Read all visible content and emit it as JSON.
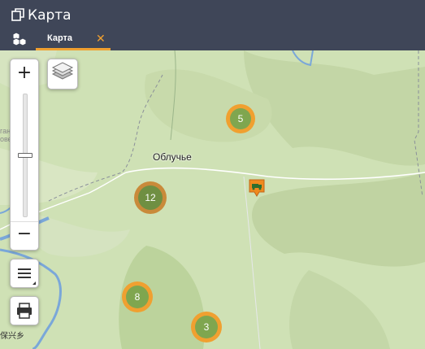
{
  "window": {
    "title": "Карта"
  },
  "tabs": [
    {
      "label": "Карта",
      "close_icon": "close-icon"
    }
  ],
  "map": {
    "city_label": "Облучье",
    "faint_labels": [
      "ганский",
      "оведник"
    ],
    "bottom_label": "保兴乡",
    "zoom": {
      "in_label": "+",
      "out_label": "−",
      "level_fraction": 0.5
    },
    "clusters": [
      {
        "count": "5"
      },
      {
        "count": "12"
      },
      {
        "count": "8"
      },
      {
        "count": "3"
      }
    ],
    "marker": {
      "icon": "truck-marker-icon",
      "color": "#f08a1e"
    }
  },
  "colors": {
    "header_bg": "#3f4658",
    "accent": "#f0a030",
    "cluster_fill": "#7fa64f",
    "cluster_ring": "#f0a030"
  }
}
